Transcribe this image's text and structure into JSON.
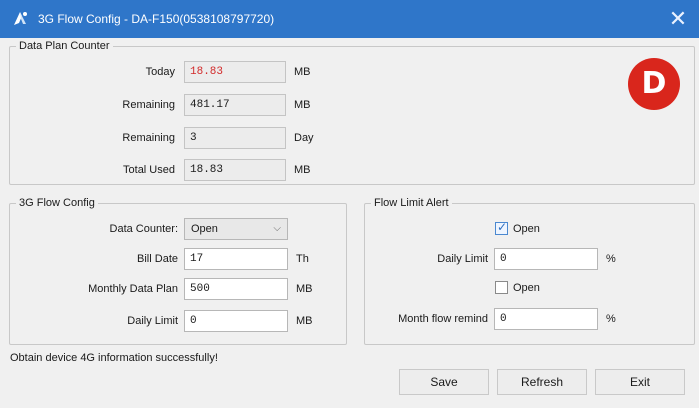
{
  "window": {
    "title": "3G Flow Config - DA-F150(0538108797720)",
    "close_label": "✕"
  },
  "badge": {
    "letter": "D",
    "color": "#d9261c"
  },
  "data_plan_counter": {
    "legend": "Data Plan Counter",
    "rows": [
      {
        "label": "Today",
        "value": "18.83",
        "unit": "MB"
      },
      {
        "label": "Remaining",
        "value": "481.17",
        "unit": "MB"
      },
      {
        "label": "Remaining",
        "value": "3",
        "unit": "Day"
      },
      {
        "label": "Total Used",
        "value": "18.83",
        "unit": "MB"
      }
    ]
  },
  "flow_config": {
    "legend": "3G Flow Config",
    "data_counter": {
      "label": "Data Counter:",
      "value": "Open"
    },
    "bill_date": {
      "label": "Bill Date",
      "value": "17",
      "unit": "Th"
    },
    "monthly_plan": {
      "label": "Monthly Data Plan",
      "value": "500",
      "unit": "MB"
    },
    "daily_limit": {
      "label": "Daily Limit",
      "value": "0",
      "unit": "MB"
    }
  },
  "flow_limit_alert": {
    "legend": "Flow Limit Alert",
    "open1": {
      "label": "Open",
      "checked": true
    },
    "daily_limit": {
      "label": "Daily Limit",
      "value": "0",
      "unit": "%"
    },
    "open2": {
      "label": "Open",
      "checked": false
    },
    "month_remind": {
      "label": "Month flow remind",
      "value": "0",
      "unit": "%"
    }
  },
  "status": "Obtain device 4G information successfully!",
  "buttons": {
    "save": "Save",
    "refresh": "Refresh",
    "exit": "Exit"
  },
  "colors": {
    "titlebar": "#2f76c9",
    "today_value": "#d22a2a",
    "background": "#f0f0f0"
  }
}
